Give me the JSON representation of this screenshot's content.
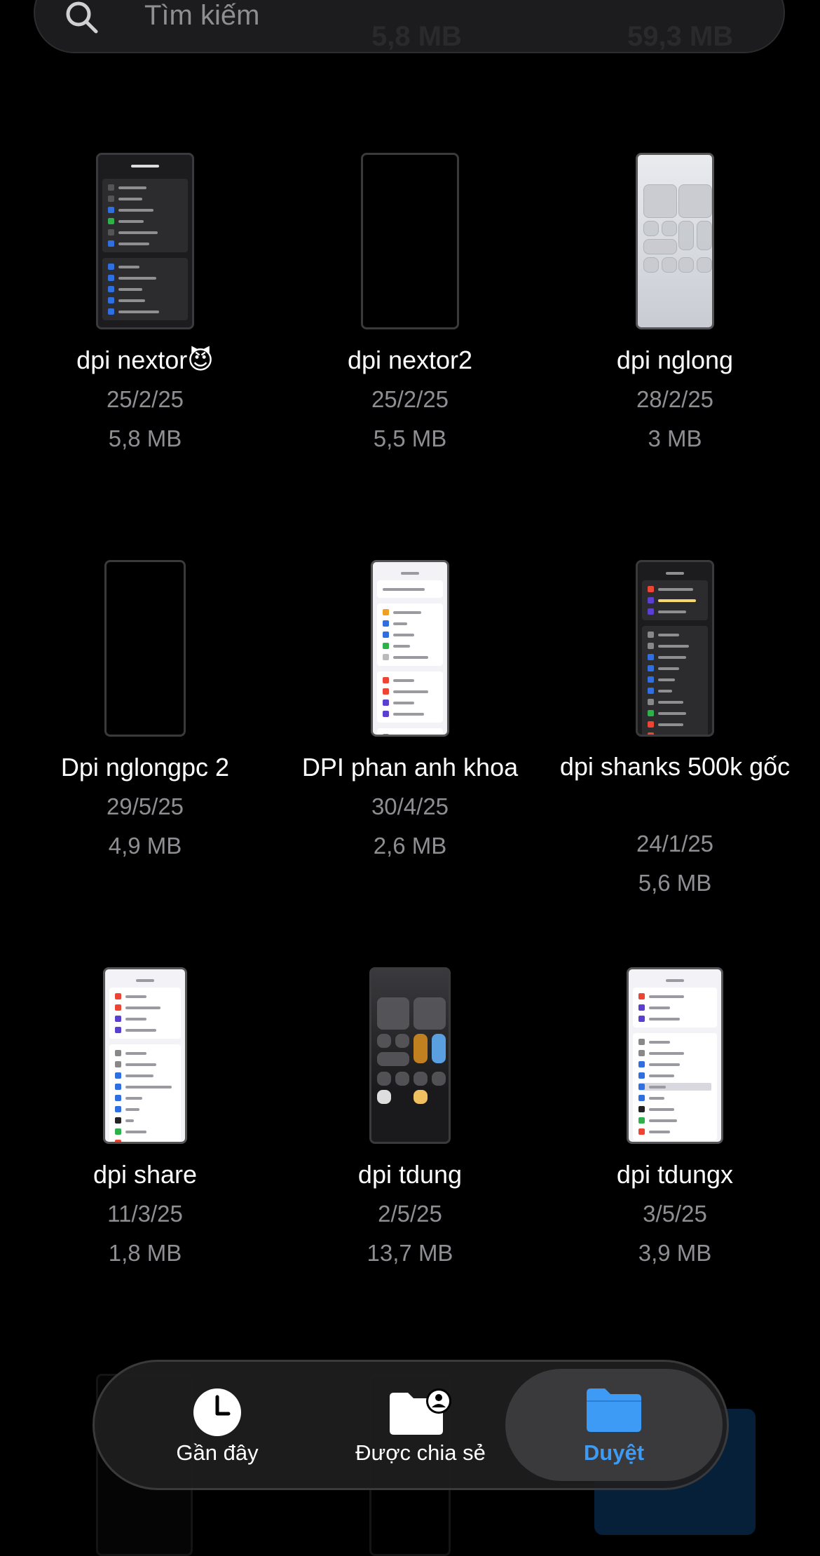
{
  "search": {
    "placeholder": "Tìm kiếm",
    "ghost_left": "5,8 MB",
    "ghost_right": "59,3 MB"
  },
  "files": [
    {
      "name": "dpi nextor😈",
      "date": "25/2/25",
      "size": "5,8 MB"
    },
    {
      "name": "dpi nextor2",
      "date": "25/2/25",
      "size": "5,5 MB"
    },
    {
      "name": "dpi nglong",
      "date": "28/2/25",
      "size": "3 MB"
    },
    {
      "name": "Dpi nglongpc 2",
      "date": "29/5/25",
      "size": "4,9 MB"
    },
    {
      "name": "DPI phan anh khoa",
      "date": "30/4/25",
      "size": "2,6 MB"
    },
    {
      "name": "dpi shanks 500k gốc",
      "date": "24/1/25",
      "size": "5,6 MB"
    },
    {
      "name": "dpi share",
      "date": "11/3/25",
      "size": "1,8 MB"
    },
    {
      "name": "dpi tdung",
      "date": "2/5/25",
      "size": "13,7 MB"
    },
    {
      "name": "dpi tdungx",
      "date": "3/5/25",
      "size": "3,9 MB"
    }
  ],
  "tabbar": {
    "tabs": [
      {
        "label": "Gần đây",
        "icon": "clock-icon"
      },
      {
        "label": "Được chia sẻ",
        "icon": "shared-folder-icon"
      },
      {
        "label": "Duyệt",
        "icon": "folder-icon",
        "active": true
      }
    ]
  },
  "colors": {
    "accent": "#3d9bf5",
    "background": "#000000",
    "secondary_text": "#8e8e93"
  }
}
